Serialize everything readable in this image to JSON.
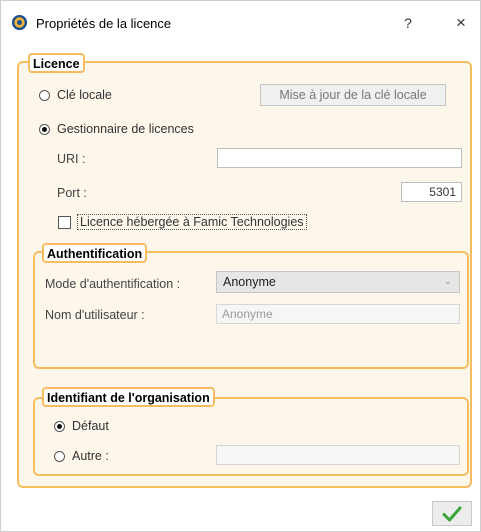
{
  "window": {
    "title": "Propriétés de la licence",
    "help": "?",
    "close": "×"
  },
  "licence_group": {
    "label": "Licence",
    "local_key": {
      "label": "Clé locale",
      "selected": false
    },
    "update_button": "Mise à jour de la clé locale",
    "license_manager": {
      "label": "Gestionnaire de licences",
      "selected": true
    },
    "uri": {
      "label": "URI :",
      "value": ""
    },
    "port": {
      "label": "Port :",
      "value": "5301"
    },
    "hosted_checkbox": {
      "label": "Licence hébergée à Famic Technologies",
      "checked": false
    }
  },
  "auth_group": {
    "label": "Authentification",
    "mode": {
      "label": "Mode d'authentification :",
      "value": "Anonyme"
    },
    "username": {
      "label": "Nom d'utilisateur :",
      "value": "Anonyme"
    }
  },
  "org_group": {
    "label": "Identifiant de l'organisation",
    "default": {
      "label": "Défaut",
      "selected": true
    },
    "other": {
      "label": "Autre :",
      "selected": false,
      "value": ""
    }
  },
  "ok_button": "✓",
  "colors": {
    "group_border": "#f5bd5f",
    "group_fill": "#fdf6eb",
    "ok_check": "#3aa63a"
  }
}
